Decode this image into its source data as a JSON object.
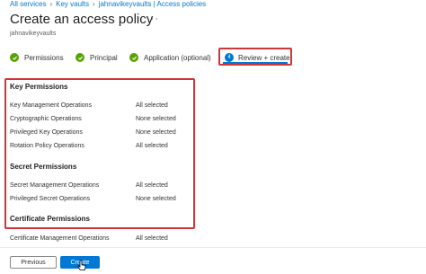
{
  "breadcrumb": [
    "All services",
    "Key vaults",
    "jahnavikeyvaults | Access policies"
  ],
  "page": {
    "title": "Create an access policy",
    "more": "···",
    "subtitle": "jahnavikeyvaults"
  },
  "steps": [
    {
      "label": "Permissions",
      "status": "complete"
    },
    {
      "label": "Principal",
      "status": "complete"
    },
    {
      "label": "Application (optional)",
      "status": "complete"
    },
    {
      "label": "Review + create",
      "number": "4",
      "status": "active"
    }
  ],
  "sections": [
    {
      "title": "Key Permissions",
      "rows": [
        {
          "label": "Key Management Operations",
          "value": "All selected"
        },
        {
          "label": "Cryptographic Operations",
          "value": "None selected"
        },
        {
          "label": "Privileged Key Operations",
          "value": "None selected"
        },
        {
          "label": "Rotation Policy Operations",
          "value": "All selected"
        }
      ]
    },
    {
      "title": "Secret Permissions",
      "rows": [
        {
          "label": "Secret Management Operations",
          "value": "All selected"
        },
        {
          "label": "Privileged Secret Operations",
          "value": "None selected"
        }
      ]
    },
    {
      "title": "Certificate Permissions",
      "rows": [
        {
          "label": "Certificate Management Operations",
          "value": "All selected"
        }
      ]
    }
  ],
  "buttons": {
    "previous": "Previous",
    "create": "Create"
  },
  "colors": {
    "accent": "#0078d4",
    "success": "#57a300",
    "highlight": "#d13438"
  }
}
